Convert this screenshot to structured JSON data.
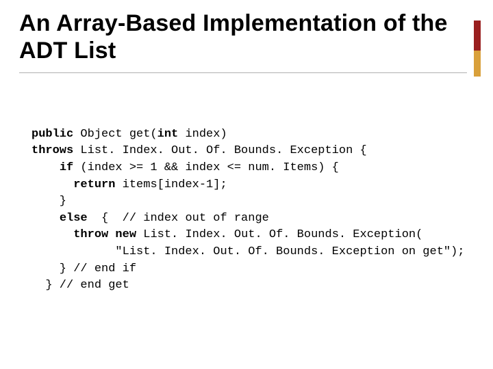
{
  "title": "An Array-Based Implementation of the ADT List",
  "code": {
    "l1": {
      "k1": "public",
      "t1": " Object get(",
      "k2": "int",
      "t2": " index)"
    },
    "l2": {
      "k1": "throws",
      "t1": " List. Index. Out. Of. Bounds. Exception {"
    },
    "l3": {
      "pad": "    ",
      "k1": "if",
      "t1": " (index >= 1 && index <= num. Items) {"
    },
    "l4": {
      "pad": "      ",
      "k1": "return",
      "t1": " items[index-1];"
    },
    "l5": {
      "t1": "    }"
    },
    "l6": {
      "pad": "    ",
      "k1": "else",
      "t1": "  {  // index out of range"
    },
    "l7": {
      "pad": "      ",
      "k1": "throw new",
      "t1": " List. Index. Out. Of. Bounds. Exception("
    },
    "l8": {
      "t1": "            \"List. Index. Out. Of. Bounds. Exception on get\");"
    },
    "l9": {
      "t1": "    } // end if"
    },
    "l10": {
      "t1": "  } // end get"
    }
  }
}
